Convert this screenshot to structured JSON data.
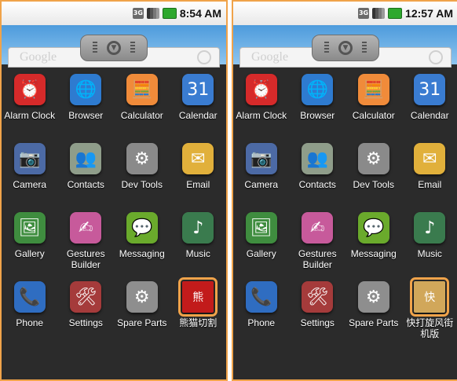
{
  "screens": [
    {
      "time": "8:54 AM",
      "search_text": "Google",
      "apps": [
        {
          "label": "Alarm Clock",
          "icon": "alarm-clock-icon",
          "color": "#d62a2a",
          "glyph": "⏰"
        },
        {
          "label": "Browser",
          "icon": "globe-icon",
          "color": "#2e7bd0",
          "glyph": "🌐"
        },
        {
          "label": "Calculator",
          "icon": "calculator-icon",
          "color": "#f08b3a",
          "glyph": "🧮"
        },
        {
          "label": "Calendar",
          "icon": "calendar-icon",
          "color": "#3a7cd1",
          "glyph": "31"
        },
        {
          "label": "Camera",
          "icon": "camera-icon",
          "color": "#4c6aa5",
          "glyph": "📷"
        },
        {
          "label": "Contacts",
          "icon": "contacts-icon",
          "color": "#8f9d8a",
          "glyph": "👥"
        },
        {
          "label": "Dev Tools",
          "icon": "gear-icon",
          "color": "#8a8a8a",
          "glyph": "⚙"
        },
        {
          "label": "Email",
          "icon": "email-icon",
          "color": "#e1b03b",
          "glyph": "✉"
        },
        {
          "label": "Gallery",
          "icon": "gallery-icon",
          "color": "#3f8d3f",
          "glyph": "🖼"
        },
        {
          "label": "Gestures Builder",
          "icon": "gestures-icon",
          "color": "#c75a9b",
          "glyph": "✍"
        },
        {
          "label": "Messaging",
          "icon": "message-icon",
          "color": "#6aaa2c",
          "glyph": "💬"
        },
        {
          "label": "Music",
          "icon": "music-icon",
          "color": "#3a7b4e",
          "glyph": "♪"
        },
        {
          "label": "Phone",
          "icon": "phone-icon",
          "color": "#2f6dc1",
          "glyph": "📞"
        },
        {
          "label": "Settings",
          "icon": "settings-icon",
          "color": "#a53b3b",
          "glyph": "🛠"
        },
        {
          "label": "Spare Parts",
          "icon": "spare-parts-icon",
          "color": "#8e8e8e",
          "glyph": "⚙"
        },
        {
          "label": "熊猫切割",
          "icon": "game-icon",
          "color": "#c21b1b",
          "glyph": "熊",
          "highlight": true
        }
      ]
    },
    {
      "time": "12:57 AM",
      "search_text": "Google",
      "apps": [
        {
          "label": "Alarm Clock",
          "icon": "alarm-clock-icon",
          "color": "#d62a2a",
          "glyph": "⏰"
        },
        {
          "label": "Browser",
          "icon": "globe-icon",
          "color": "#2e7bd0",
          "glyph": "🌐"
        },
        {
          "label": "Calculator",
          "icon": "calculator-icon",
          "color": "#f08b3a",
          "glyph": "🧮"
        },
        {
          "label": "Calendar",
          "icon": "calendar-icon",
          "color": "#3a7cd1",
          "glyph": "31"
        },
        {
          "label": "Camera",
          "icon": "camera-icon",
          "color": "#4c6aa5",
          "glyph": "📷"
        },
        {
          "label": "Contacts",
          "icon": "contacts-icon",
          "color": "#8f9d8a",
          "glyph": "👥"
        },
        {
          "label": "Dev Tools",
          "icon": "gear-icon",
          "color": "#8a8a8a",
          "glyph": "⚙"
        },
        {
          "label": "Email",
          "icon": "email-icon",
          "color": "#e1b03b",
          "glyph": "✉"
        },
        {
          "label": "Gallery",
          "icon": "gallery-icon",
          "color": "#3f8d3f",
          "glyph": "🖼"
        },
        {
          "label": "Gestures Builder",
          "icon": "gestures-icon",
          "color": "#c75a9b",
          "glyph": "✍"
        },
        {
          "label": "Messaging",
          "icon": "message-icon",
          "color": "#6aaa2c",
          "glyph": "💬"
        },
        {
          "label": "Music",
          "icon": "music-icon",
          "color": "#3a7b4e",
          "glyph": "♪"
        },
        {
          "label": "Phone",
          "icon": "phone-icon",
          "color": "#2f6dc1",
          "glyph": "📞"
        },
        {
          "label": "Settings",
          "icon": "settings-icon",
          "color": "#a53b3b",
          "glyph": "🛠"
        },
        {
          "label": "Spare Parts",
          "icon": "spare-parts-icon",
          "color": "#8e8e8e",
          "glyph": "⚙"
        },
        {
          "label": "快打旋风街机版",
          "icon": "game-icon",
          "color": "#d1a75a",
          "glyph": "快",
          "highlight": true
        }
      ]
    }
  ],
  "highlight_color": "#f0a34a"
}
